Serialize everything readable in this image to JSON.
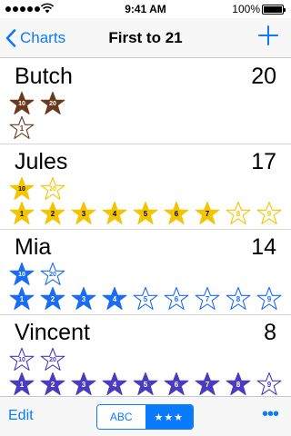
{
  "status_bar": {
    "time": "9:41 AM",
    "battery": "100%"
  },
  "nav": {
    "back_label": "Charts",
    "title": "First to 21"
  },
  "players": [
    {
      "name": "Butch",
      "score": "20",
      "color": "#6b3a1e",
      "text_color": "#ffffff",
      "milestones": [
        {
          "label": "10",
          "filled": true
        },
        {
          "label": "20",
          "filled": true
        }
      ],
      "stars": [
        {
          "label": "1",
          "filled": false
        }
      ]
    },
    {
      "name": "Jules",
      "score": "17",
      "color": "#f5c400",
      "text_color": "#000000",
      "milestones": [
        {
          "label": "10",
          "filled": true
        },
        {
          "label": "20",
          "filled": false
        }
      ],
      "stars": [
        {
          "label": "1",
          "filled": true
        },
        {
          "label": "2",
          "filled": true
        },
        {
          "label": "3",
          "filled": true
        },
        {
          "label": "4",
          "filled": true
        },
        {
          "label": "5",
          "filled": true
        },
        {
          "label": "6",
          "filled": true
        },
        {
          "label": "7",
          "filled": true
        },
        {
          "label": "8",
          "filled": false
        },
        {
          "label": "9",
          "filled": false
        }
      ]
    },
    {
      "name": "Mia",
      "score": "14",
      "color": "#1a6cf2",
      "text_color": "#ffffff",
      "milestones": [
        {
          "label": "10",
          "filled": true
        },
        {
          "label": "20",
          "filled": false
        }
      ],
      "stars": [
        {
          "label": "1",
          "filled": true
        },
        {
          "label": "2",
          "filled": true
        },
        {
          "label": "3",
          "filled": true
        },
        {
          "label": "4",
          "filled": true
        },
        {
          "label": "5",
          "filled": false
        },
        {
          "label": "6",
          "filled": false
        },
        {
          "label": "7",
          "filled": false
        },
        {
          "label": "8",
          "filled": false
        },
        {
          "label": "9",
          "filled": false
        }
      ]
    },
    {
      "name": "Vincent",
      "score": "8",
      "color": "#4a3bbf",
      "text_color": "#ffffff",
      "milestones": [
        {
          "label": "10",
          "filled": false
        },
        {
          "label": "20",
          "filled": false
        }
      ],
      "stars": [
        {
          "label": "1",
          "filled": true
        },
        {
          "label": "2",
          "filled": true
        },
        {
          "label": "3",
          "filled": true
        },
        {
          "label": "4",
          "filled": true
        },
        {
          "label": "5",
          "filled": true
        },
        {
          "label": "6",
          "filled": true
        },
        {
          "label": "7",
          "filled": true
        },
        {
          "label": "8",
          "filled": true
        },
        {
          "label": "9",
          "filled": false
        }
      ]
    }
  ],
  "toolbar": {
    "edit_label": "Edit",
    "segments": [
      {
        "label": "ABC",
        "selected": false
      },
      {
        "label": "★★★",
        "selected": true
      }
    ],
    "more_icon": "ellipsis-icon"
  },
  "accent_color": "#0a7aff"
}
